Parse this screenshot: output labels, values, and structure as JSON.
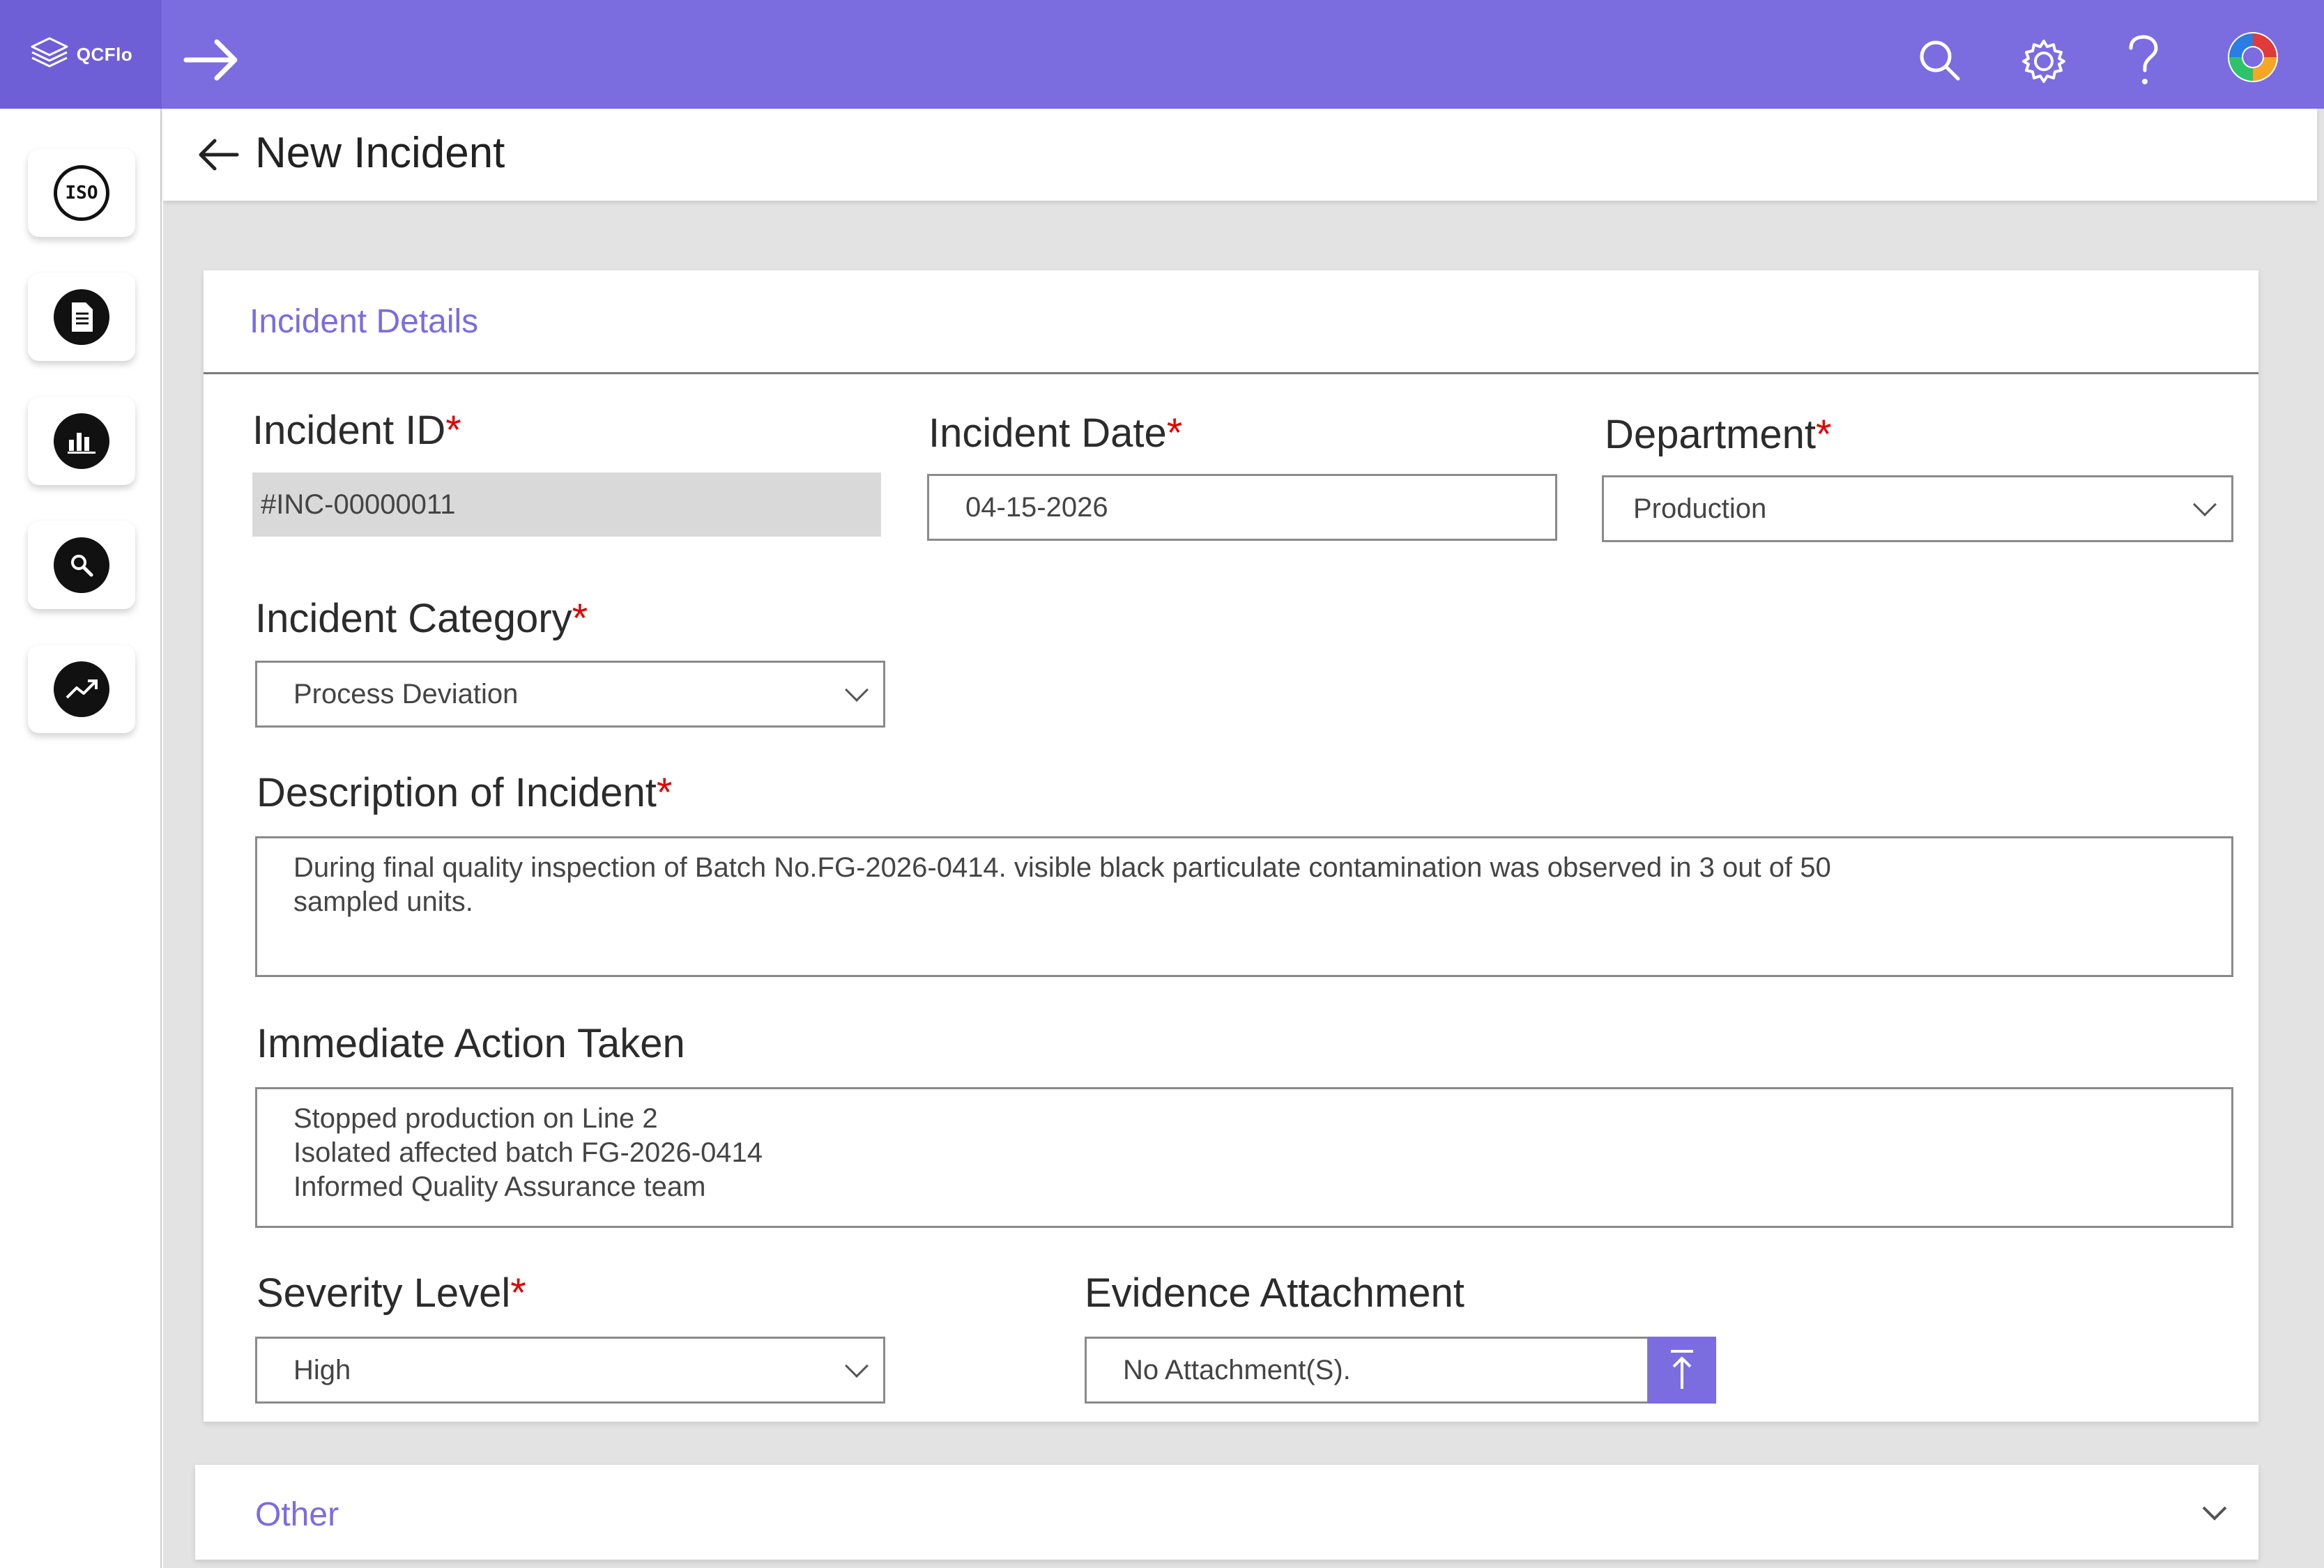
{
  "app": {
    "logo_text": "QCFlo",
    "page_title": "New Incident",
    "colors": {
      "accent": "#7B6CE0",
      "required": "#E00000",
      "readonly_bg": "#D9D9D9"
    }
  },
  "topbar": {
    "icons": [
      "arrow-right-icon",
      "search-icon",
      "gear-icon",
      "help-icon",
      "avatar"
    ]
  },
  "sidebar": {
    "items": [
      {
        "icon": "iso-icon",
        "label": "ISO"
      },
      {
        "icon": "document-icon"
      },
      {
        "icon": "bar-chart-icon"
      },
      {
        "icon": "search-icon"
      },
      {
        "icon": "trend-up-icon"
      }
    ]
  },
  "section": {
    "title": "Incident Details",
    "fields": {
      "incident_id": {
        "label": "Incident ID",
        "required_mark": "*",
        "value": "#INC-00000011"
      },
      "incident_date": {
        "label": "Incident Date",
        "required_mark": "*",
        "value": "04-15-2026"
      },
      "department": {
        "label": "Department",
        "required_mark": "*",
        "value": "Production"
      },
      "category": {
        "label": "Incident Category",
        "required_mark": "*",
        "value": "Process Deviation"
      },
      "description": {
        "label": "Description of Incident",
        "required_mark": "*",
        "lines": [
          "During final quality inspection of Batch No.FG-2026-0414. visible black particulate contamination was observed in 3 out of 50",
          "sampled units."
        ]
      },
      "immediate_action": {
        "label": "Immediate Action Taken",
        "lines": [
          "Stopped production on Line 2",
          "Isolated affected batch FG-2026-0414",
          "Informed Quality Assurance team"
        ]
      },
      "severity": {
        "label": "Severity Level",
        "required_mark": "*",
        "value": "High"
      },
      "evidence": {
        "label": "Evidence Attachment",
        "value": "No Attachment(S)."
      }
    }
  },
  "other_section": {
    "title": "Other"
  }
}
